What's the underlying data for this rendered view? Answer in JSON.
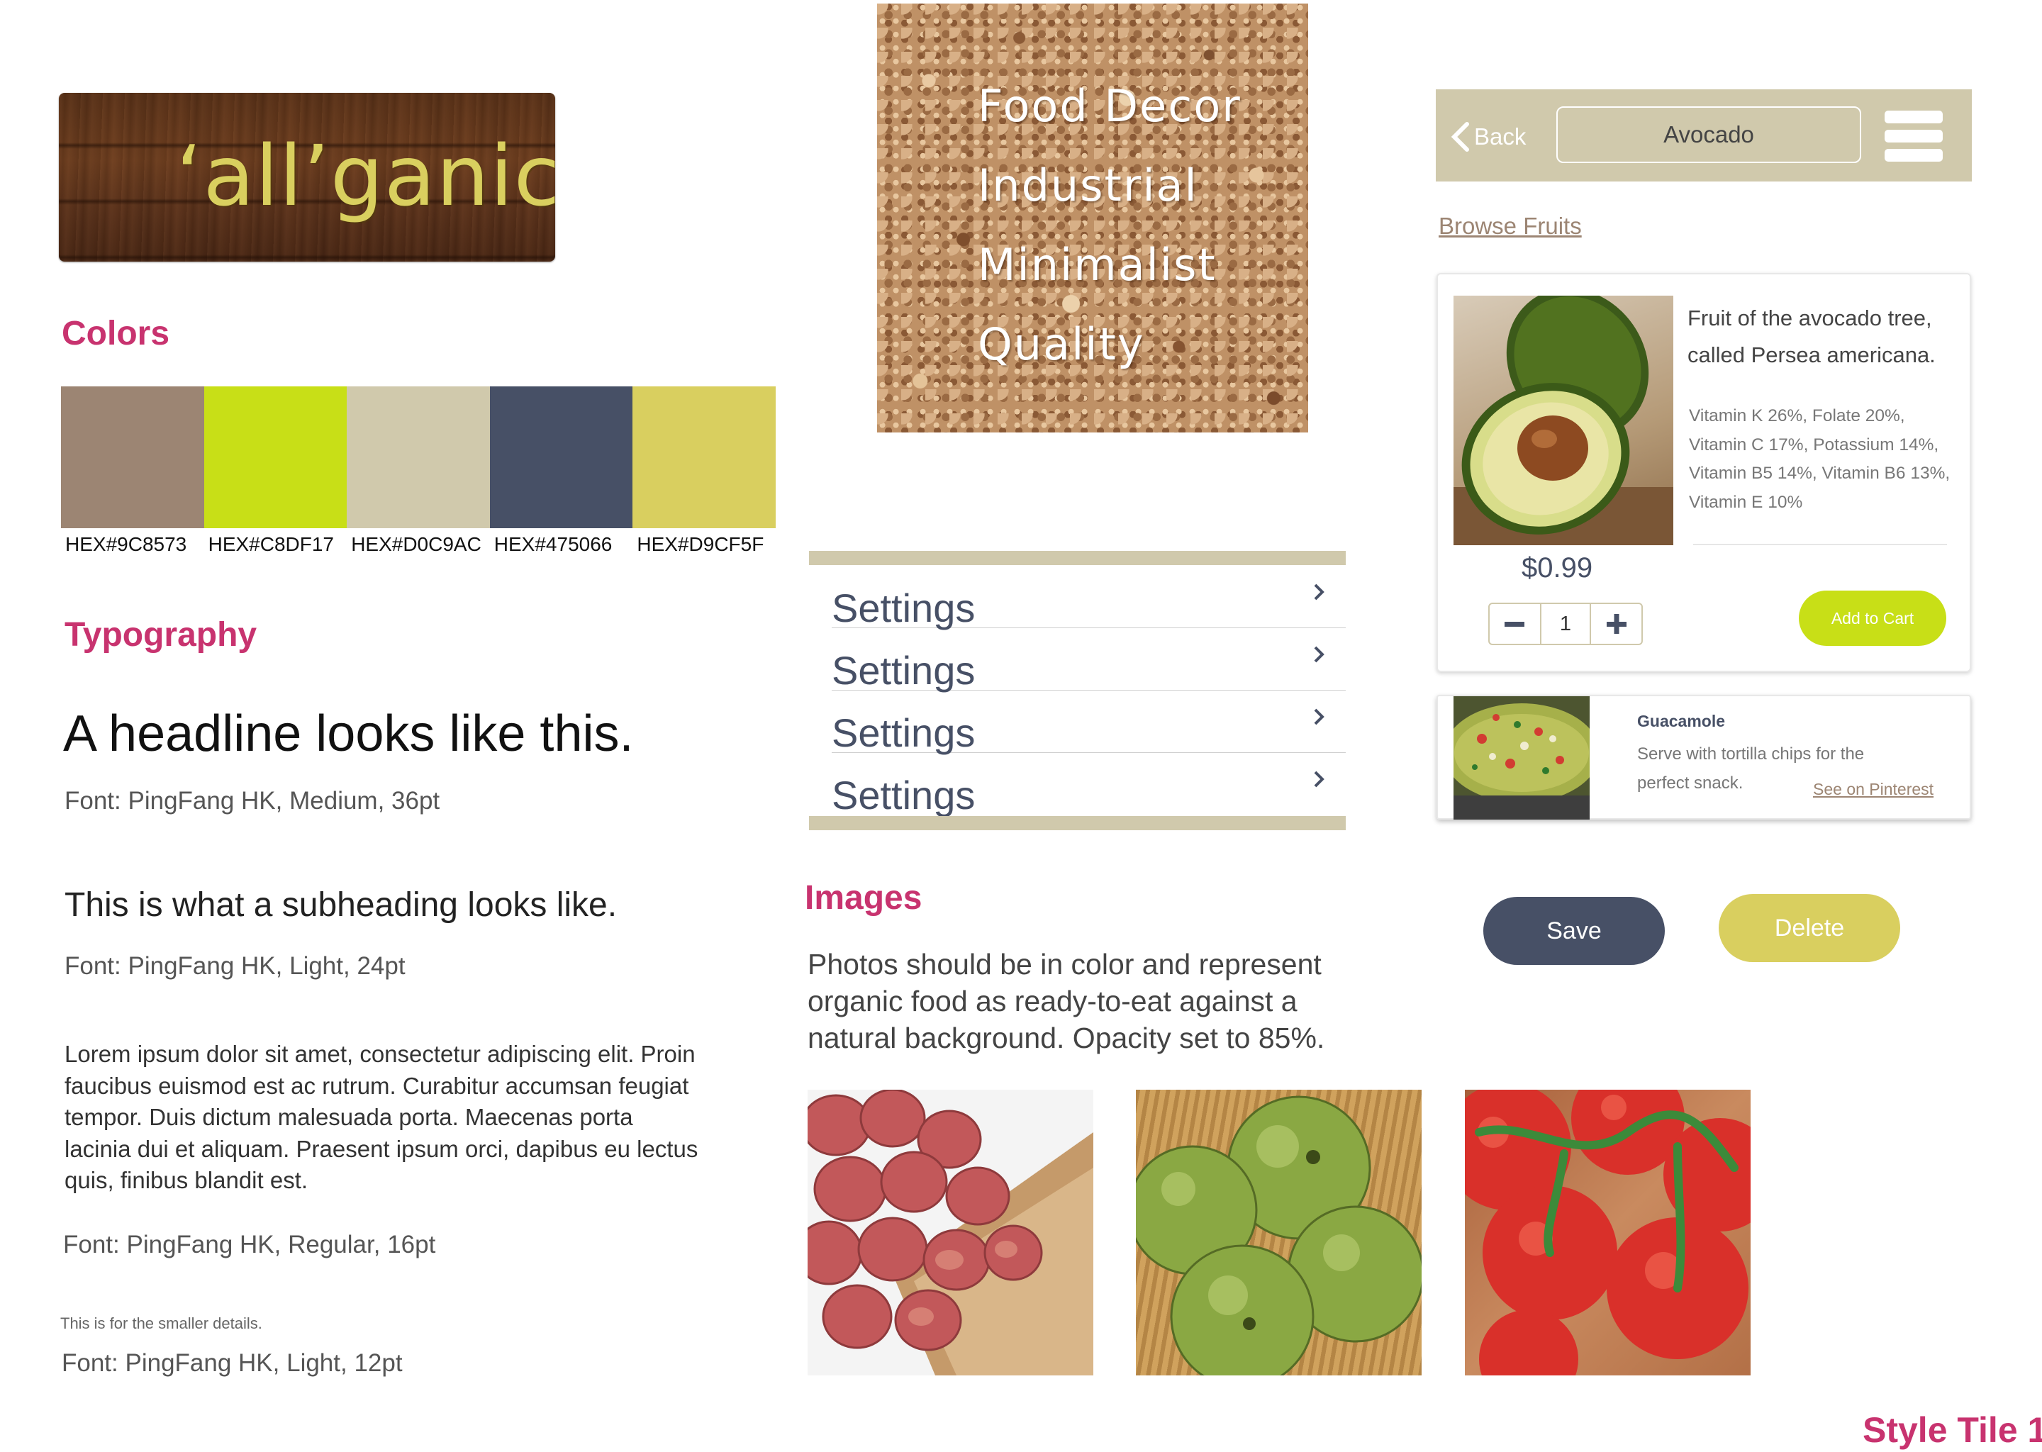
{
  "logo": {
    "text": "‘all’ganic"
  },
  "colors": {
    "heading": "Colors",
    "swatches": [
      {
        "hex": "#9C8573",
        "label": "HEX#9C8573"
      },
      {
        "hex": "#C8DF17",
        "label": "HEX#C8DF17"
      },
      {
        "hex": "#D0C9AC",
        "label": "HEX#D0C9AC"
      },
      {
        "hex": "#475066",
        "label": "HEX#475066"
      },
      {
        "hex": "#D9CF5F",
        "label": "HEX#D9CF5F"
      }
    ]
  },
  "typography": {
    "heading": "Typography",
    "headline": "A headline looks like this.",
    "headline_font": "Font: PingFang HK, Medium, 36pt",
    "subheading": "This is what a subheading looks like.",
    "subheading_font": "Font: PingFang HK, Light, 24pt",
    "body": "Lorem ipsum dolor sit amet, consectetur adipiscing elit. Proin faucibus euismod est ac rutrum. Curabitur accumsan feugiat tempor. Duis dictum malesuada porta. Maecenas porta lacinia dui et aliquam. Praesent ipsum orci, dapibus eu lectus quis, finibus blandit est.",
    "body_font": "Font: PingFang HK, Regular, 16pt",
    "small": "This is for the smaller details.",
    "small_font": "Font: PingFang HK, Light, 12pt"
  },
  "mood": {
    "words": [
      "Food Decor",
      "Industrial",
      "Minimalist",
      "Quality"
    ]
  },
  "settings": {
    "items": [
      "Settings",
      "Settings",
      "Settings",
      "Settings"
    ]
  },
  "images": {
    "heading": "Images",
    "description": "Photos should be in color and represent organic food as ready-to-eat against a natural background. Opacity set to 85%."
  },
  "mobile": {
    "back_label": "Back",
    "search_value": "Avocado",
    "browse_link": "Browse Fruits"
  },
  "product": {
    "description": "Fruit of the avocado tree, called Persea americana.",
    "nutrition": "Vitamin K 26%, Folate 20%, Vitamin C 17%, Potassium 14%, Vitamin B5 14%, Vitamin B6 13%, Vitamin E 10%",
    "price": "$0.99",
    "quantity": "1",
    "add_to_cart": "Add to Cart"
  },
  "recipe": {
    "title": "Guacamole",
    "description": "Serve with tortilla chips for the perfect snack.",
    "link": "See on Pinterest"
  },
  "buttons": {
    "save": "Save",
    "delete": "Delete"
  },
  "footer": {
    "label": "Style Tile 1"
  }
}
